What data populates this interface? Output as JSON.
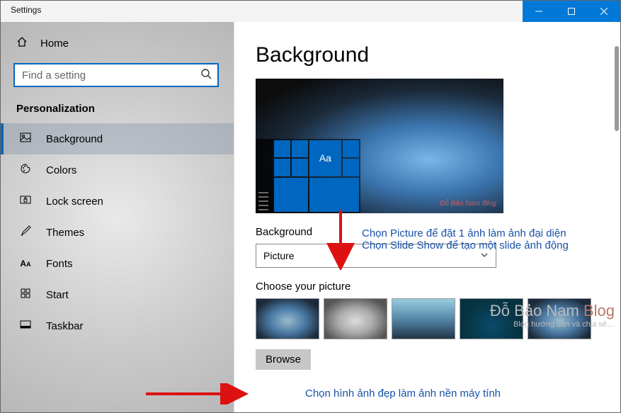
{
  "window": {
    "title": "Settings"
  },
  "sidebar": {
    "home": "Home",
    "search_placeholder": "Find a setting",
    "section": "Personalization",
    "items": [
      {
        "label": "Background",
        "selected": true,
        "icon": "picture"
      },
      {
        "label": "Colors",
        "selected": false,
        "icon": "palette"
      },
      {
        "label": "Lock screen",
        "selected": false,
        "icon": "lock"
      },
      {
        "label": "Themes",
        "selected": false,
        "icon": "brush"
      },
      {
        "label": "Fonts",
        "selected": false,
        "icon": "fonts"
      },
      {
        "label": "Start",
        "selected": false,
        "icon": "start"
      },
      {
        "label": "Taskbar",
        "selected": false,
        "icon": "taskbar"
      }
    ]
  },
  "main": {
    "heading": "Background",
    "preview_sample_text": "Aa",
    "preview_watermark": "Đỗ Bảo Nam Blog",
    "bg_label": "Background",
    "bg_value": "Picture",
    "choose_label": "Choose your picture",
    "browse_label": "Browse"
  },
  "annotations": {
    "a1_line1": "Chọn Picture để đặt 1 ảnh làm ảnh đại diện",
    "a1_line2": "Chọn Slide Show để tạo một slide ảnh động",
    "a2": "Chọn hình ảnh đẹp làm ảnh nền máy tính",
    "watermark_brand_a": "Đỗ Bảo Nam ",
    "watermark_brand_b": "Blog",
    "watermark_tag": "Blog hướng dẫn và chia sẻ…"
  }
}
